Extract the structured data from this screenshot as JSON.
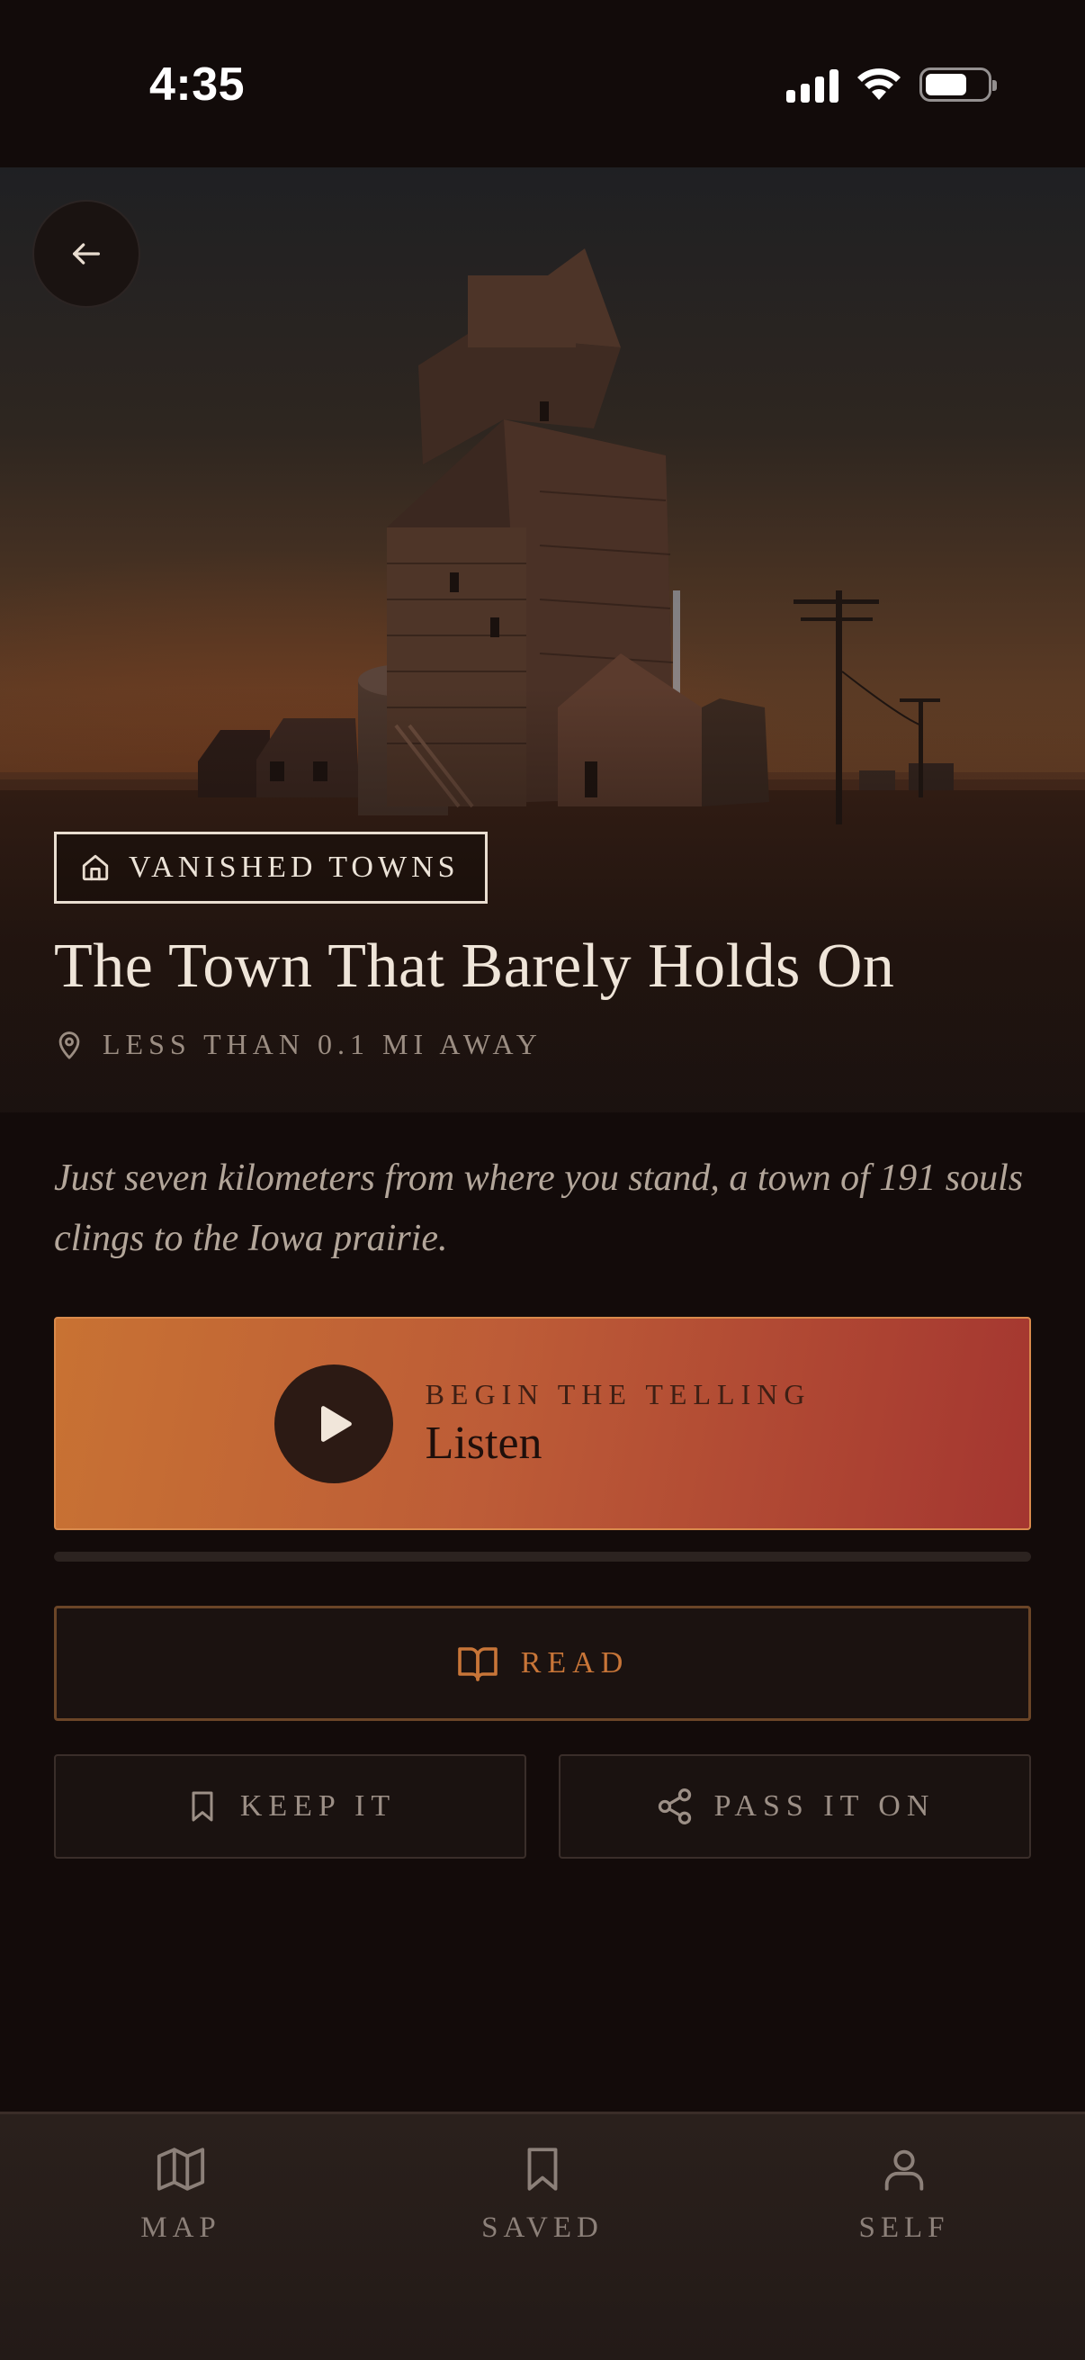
{
  "status_bar": {
    "time": "4:35"
  },
  "hero": {
    "category": "VANISHED TOWNS",
    "title": "The Town That Barely Holds On",
    "distance": "LESS THAN 0.1 MI AWAY"
  },
  "summary": "Just seven kilometers from where you stand, a town of 191 souls clings to the Iowa prairie.",
  "listen": {
    "kicker": "BEGIN THE TELLING",
    "label": "Listen",
    "progress": 0
  },
  "actions": {
    "read": "READ",
    "keep": "KEEP IT",
    "share": "PASS IT ON"
  },
  "nav": {
    "map": "MAP",
    "saved": "SAVED",
    "self": "SELF"
  },
  "colors": {
    "accent": "#c87233",
    "accent_end": "#a43630",
    "background": "#130b0a"
  }
}
